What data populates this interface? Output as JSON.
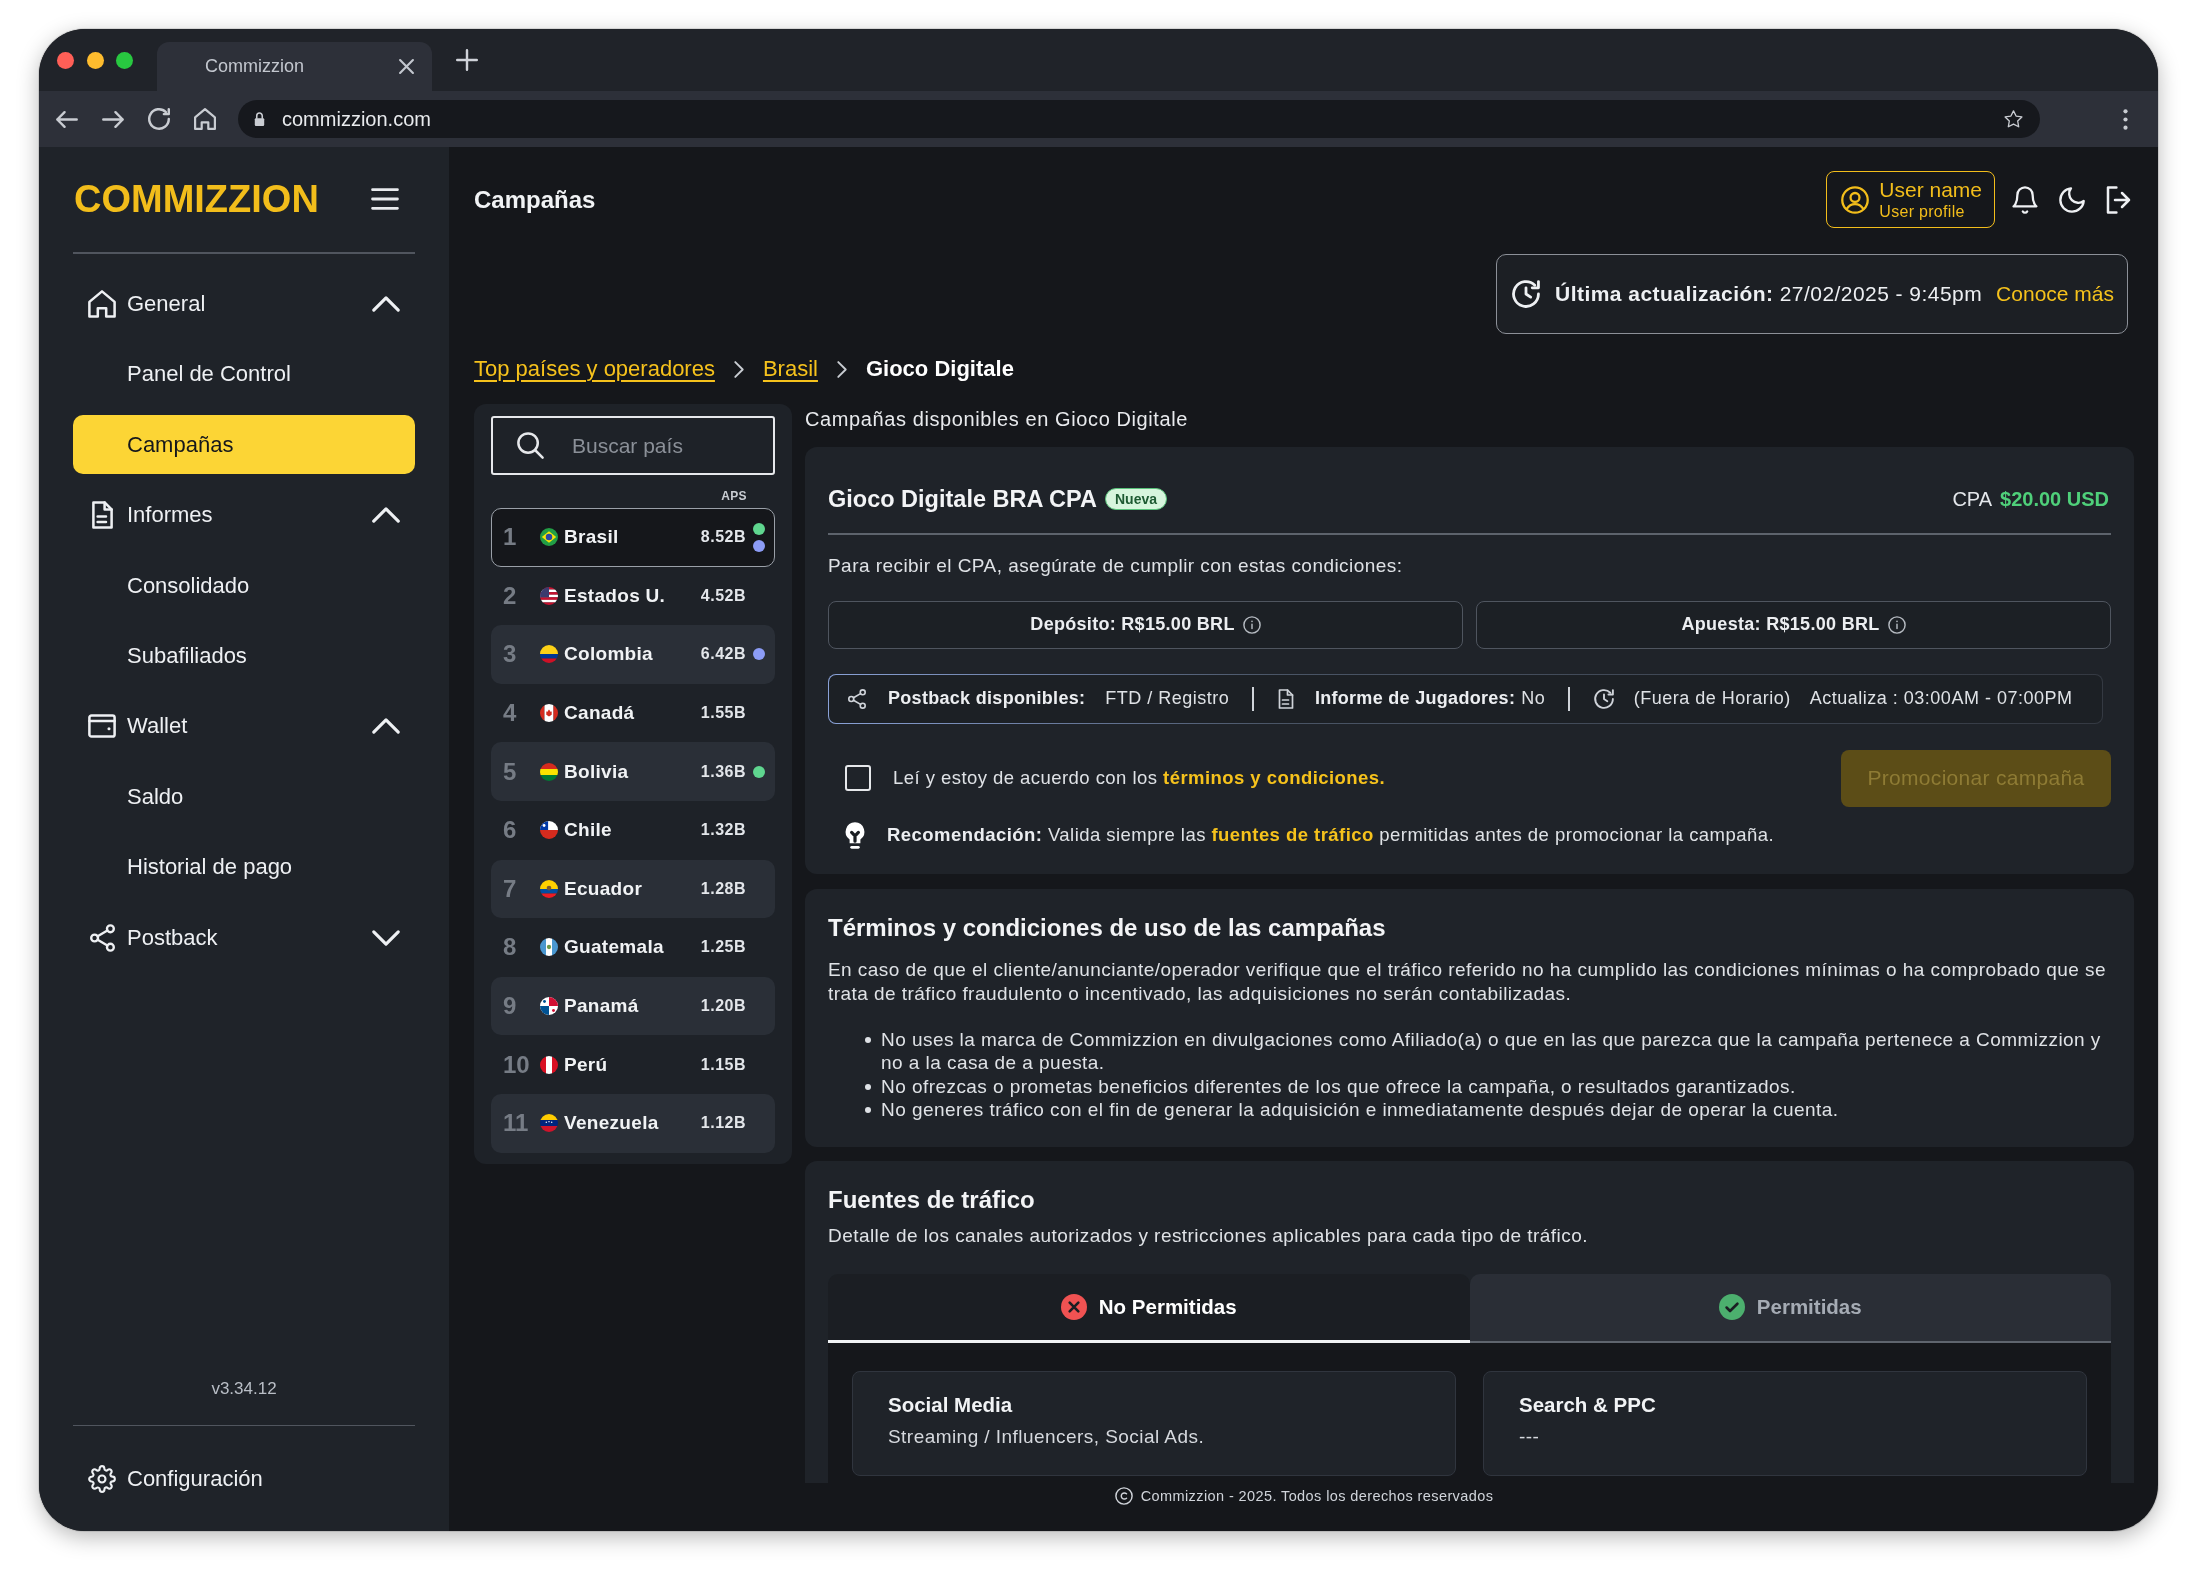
{
  "browser": {
    "tab_title": "Commizzion",
    "url": "commizzion.com"
  },
  "sidebar": {
    "logo": "COMMIZZION",
    "sections": [
      {
        "label": "General",
        "expanded": true,
        "items": [
          {
            "label": "Panel de Control",
            "selected": false
          },
          {
            "label": "Campañas",
            "selected": true
          }
        ]
      },
      {
        "label": "Informes",
        "expanded": true,
        "items": [
          {
            "label": "Consolidado",
            "selected": false
          },
          {
            "label": "Subafiliados",
            "selected": false
          }
        ]
      },
      {
        "label": "Wallet",
        "expanded": true,
        "items": [
          {
            "label": "Saldo",
            "selected": false
          },
          {
            "label": "Historial de pago",
            "selected": false
          }
        ]
      },
      {
        "label": "Postback",
        "expanded": false
      }
    ],
    "version": "v3.34.12",
    "settings": "Configuración"
  },
  "header": {
    "title": "Campañas",
    "user": {
      "name": "User name",
      "role": "User profile"
    },
    "last_update": {
      "label": "Última actualización:",
      "value": "27/02/2025 - 9:45pm",
      "link": "Conoce más"
    }
  },
  "breadcrumbs": [
    {
      "label": "Top países y operadores",
      "selected": false
    },
    {
      "label": "Brasil",
      "selected": false
    },
    {
      "label": "Gioco Digitale",
      "selected": true
    }
  ],
  "countries": {
    "search_placeholder": "Buscar país",
    "column": "APS",
    "rows": [
      {
        "rank": "1",
        "name": "Brasil",
        "value": "8.52B",
        "selected": true,
        "markers": [
          {
            "color": "#5fd68f"
          },
          {
            "color": "#8c9cf6"
          }
        ]
      },
      {
        "rank": "2",
        "name": "Estados U.",
        "value": "4.52B",
        "selected": false
      },
      {
        "rank": "3",
        "name": "Colombia",
        "value": "6.42B",
        "selected": false,
        "markers": [
          {
            "color": "#8c9cf6"
          }
        ]
      },
      {
        "rank": "4",
        "name": "Canadá",
        "value": "1.55B",
        "selected": false
      },
      {
        "rank": "5",
        "name": "Bolivia",
        "value": "1.36B",
        "selected": false,
        "markers": [
          {
            "color": "#5fd68f"
          }
        ]
      },
      {
        "rank": "6",
        "name": "Chile",
        "value": "1.32B",
        "selected": false
      },
      {
        "rank": "7",
        "name": "Ecuador",
        "value": "1.28B",
        "selected": false
      },
      {
        "rank": "8",
        "name": "Guatemala",
        "value": "1.25B",
        "selected": false
      },
      {
        "rank": "9",
        "name": "Panamá",
        "value": "1.20B",
        "selected": false
      },
      {
        "rank": "10",
        "name": "Perú",
        "value": "1.15B",
        "selected": false
      },
      {
        "rank": "11",
        "name": "Venezuela",
        "value": "1.12B",
        "selected": false
      }
    ]
  },
  "campaign": {
    "heading": "Campañas disponibles en Gioco Digitale",
    "title": "Gioco Digitale BRA CPA",
    "badge": "Nueva",
    "payout_label": "CPA",
    "payout": "$20.00 USD",
    "intro": "Para recibir el CPA, asegúrate de cumplir con estas condiciones:",
    "conditions": [
      {
        "text": "Depósito: R$15.00 BRL"
      },
      {
        "text": "Apuesta: R$15.00 BRL"
      }
    ],
    "postback_info": {
      "postback_label": "Postback disponibles:",
      "postback_value": "FTD / Registro",
      "report_label": "Informe de Jugadores:",
      "report_value": "No",
      "schedule_status": "(Fuera de Horario)",
      "schedule_hours": "Actualiza : 03:00AM - 07:00PM"
    },
    "agreement": {
      "text": "Leí y estoy de acuerdo con los",
      "link": "términos y condiciones",
      "suffix": ".",
      "checked": false
    },
    "promote_button": {
      "label": "Promocionar campaña",
      "disabled": true
    },
    "recommendation": {
      "label": "Recomendación:",
      "text_before": "Valida siempre las",
      "link": "fuentes de tráfico",
      "text_after": "permitidas antes de promocionar la campaña."
    }
  },
  "terms": {
    "title": "Términos y condiciones de uso de las campañas",
    "intro": "En caso de que el cliente/anunciante/operador verifique que el tráfico referido no ha cumplido las condiciones mínimas o ha comprobado que se trata de tráfico fraudulento o incentivado, las adquisiciones no serán contabilizadas.",
    "rules": [
      "No uses la marca de Commizzion en divulgaciones como Afiliado(a) o que en las que parezca que la campaña pertenece a Commizzion y no a la casa de a puesta.",
      "No ofrezcas o prometas beneficios diferentes de los que ofrece la campaña, o resultados garantizados.",
      "No generes tráfico con el fin de generar la adquisición e inmediatamente después dejar de operar la cuenta."
    ]
  },
  "traffic_sources": {
    "title": "Fuentes de tráfico",
    "subtitle": "Detalle de los canales autorizados y restricciones aplicables para cada tipo de tráfico.",
    "tabs": [
      {
        "label": "No Permitidas",
        "kind": "blocked",
        "selected": true
      },
      {
        "label": "Permitidas",
        "kind": "allowed",
        "selected": false
      }
    ],
    "sources": [
      {
        "name": "Social Media",
        "detail": "Streaming / Influencers, Social Ads."
      },
      {
        "name": "Search & PPC",
        "detail": "---"
      }
    ]
  },
  "footer": "Commizzion - 2025. Todos los derechos reservados"
}
